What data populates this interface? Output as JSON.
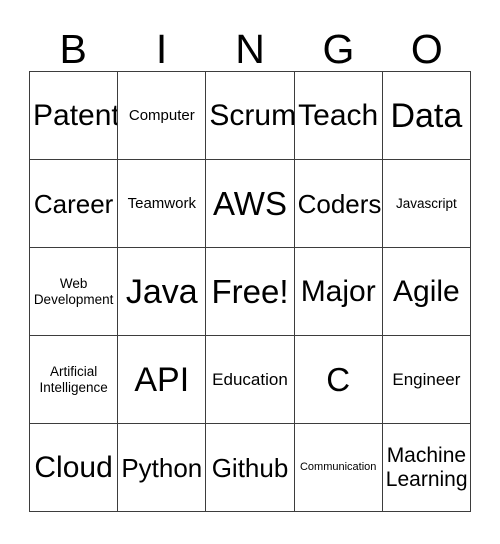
{
  "card": {
    "header_letters": [
      "B",
      "I",
      "N",
      "G",
      "O"
    ],
    "border_color": "#3d3d3d",
    "background_color": "#ffffff",
    "text_color": "#000000",
    "rows": 5,
    "columns": 5,
    "free_space_label": "Free!",
    "cells": [
      {
        "label": "Patent",
        "size": "lg"
      },
      {
        "label": "Computer",
        "size": "xxs"
      },
      {
        "label": "Scrum",
        "size": "lg"
      },
      {
        "label": "Teach",
        "size": "lg"
      },
      {
        "label": "Data",
        "size": "xxl"
      },
      {
        "label": "Career",
        "size": "md"
      },
      {
        "label": "Teamwork",
        "size": "xxs"
      },
      {
        "label": "AWS",
        "size": "xl"
      },
      {
        "label": "Coders",
        "size": "md"
      },
      {
        "label": "Javascript",
        "size": "tiny"
      },
      {
        "label": "Web\nDevelopment",
        "size": "tiny"
      },
      {
        "label": "Java",
        "size": "xxl"
      },
      {
        "label": "Free!",
        "size": "xl"
      },
      {
        "label": "Major",
        "size": "lg"
      },
      {
        "label": "Agile",
        "size": "lg"
      },
      {
        "label": "Artificial\nIntelligence",
        "size": "tiny"
      },
      {
        "label": "API",
        "size": "xxl"
      },
      {
        "label": "Education",
        "size": "xs"
      },
      {
        "label": "C",
        "size": "xl"
      },
      {
        "label": "Engineer",
        "size": "xs"
      },
      {
        "label": "Cloud",
        "size": "lg"
      },
      {
        "label": "Python",
        "size": "md"
      },
      {
        "label": "Github",
        "size": "md"
      },
      {
        "label": "Communication",
        "size": "min"
      },
      {
        "label": "Machine\nLearning",
        "size": "sm"
      }
    ]
  }
}
